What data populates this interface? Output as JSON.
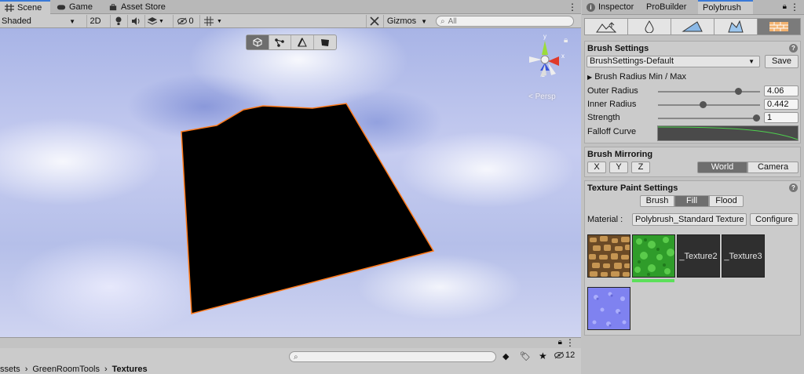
{
  "scene_tabs": [
    {
      "label": "Scene",
      "icon": "hash-icon",
      "active": true
    },
    {
      "label": "Game",
      "icon": "gamepad-icon",
      "active": false
    },
    {
      "label": "Asset Store",
      "icon": "bag-icon",
      "active": false
    }
  ],
  "scene_toolbar": {
    "shading_mode": "Shaded",
    "mode_2d": "2D",
    "hidden_count": "0",
    "gizmos_label": "Gizmos",
    "search_placeholder": "All"
  },
  "viewport": {
    "persp_label": "< Persp",
    "tools": [
      "object-icon",
      "vertex-icon",
      "edge-icon",
      "face-icon"
    ],
    "active_tool_index": 0,
    "mesh_color": "#000000",
    "mesh_outline_color": "#ff7a1a"
  },
  "bottom_bar": {
    "search_placeholder": "",
    "hidden_count": "12",
    "breadcrumb": [
      "ssets",
      "GreenRoomTools",
      "Textures"
    ]
  },
  "inspector": {
    "tabs": [
      {
        "label": "Inspector",
        "icon": "info-icon",
        "active": false
      },
      {
        "label": "ProBuilder",
        "active": false
      },
      {
        "label": "Polybrush",
        "active": true
      }
    ],
    "modes": [
      "sculpt-icon",
      "smooth-icon",
      "paint-color-icon",
      "prefab-icon",
      "paint-texture-icon"
    ],
    "active_mode_index": 4,
    "brush_settings": {
      "title": "Brush Settings",
      "preset": "BrushSettings-Default",
      "save_label": "Save",
      "radius_foldout": "Brush Radius Min / Max",
      "outer_radius_label": "Outer Radius",
      "outer_radius_value": "4.06",
      "outer_radius_fraction": 0.81,
      "inner_radius_label": "Inner Radius",
      "inner_radius_value": "0.442",
      "inner_radius_fraction": 0.44,
      "strength_label": "Strength",
      "strength_value": "1",
      "strength_fraction": 1.0,
      "falloff_label": "Falloff Curve"
    },
    "brush_mirroring": {
      "title": "Brush Mirroring",
      "axes": [
        "X",
        "Y",
        "Z"
      ],
      "spaces": [
        "World",
        "Camera"
      ],
      "active_space": "World"
    },
    "texture_paint": {
      "title": "Texture Paint Settings",
      "modes": [
        "Brush",
        "Fill",
        "Flood"
      ],
      "active_mode": "Fill",
      "material_label": "Material :",
      "material_value": "Polybrush_Standard Texture",
      "configure_label": "Configure",
      "slots": [
        {
          "name": "dirt-texture",
          "label": "",
          "type": "image"
        },
        {
          "name": "grass-texture",
          "label": "",
          "type": "image",
          "selected": true
        },
        {
          "name": "texture2-slot",
          "label": "_Texture2",
          "type": "empty"
        },
        {
          "name": "texture3-slot",
          "label": "_Texture3",
          "type": "empty"
        },
        {
          "name": "normal-texture",
          "label": "",
          "type": "image"
        }
      ]
    }
  }
}
